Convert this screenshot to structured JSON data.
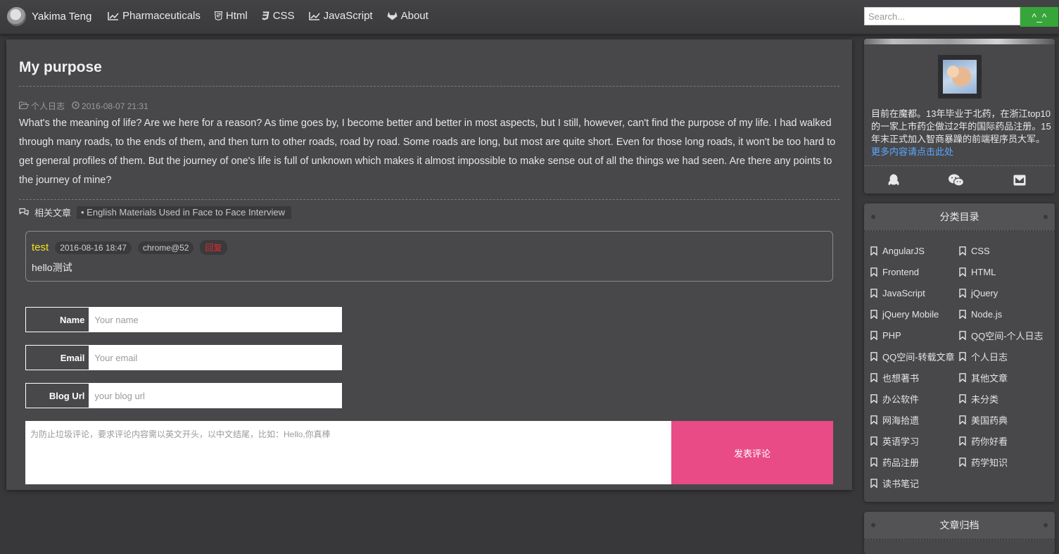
{
  "nav": {
    "brand": "Yakima Teng",
    "items": [
      {
        "label": "Pharmaceuticals",
        "icon": "line-chart-icon"
      },
      {
        "label": "Html",
        "icon": "html5-icon"
      },
      {
        "label": "CSS",
        "icon": "css3-icon"
      },
      {
        "label": "JavaScript",
        "icon": "line-chart-icon"
      },
      {
        "label": "About",
        "icon": "gitlab-icon"
      }
    ],
    "search_placeholder": "Search...",
    "search_button": "^_^"
  },
  "article": {
    "title": "My purpose",
    "category": "个人日志",
    "date": "2016-08-07 21:31",
    "body": "What's the meaning of life? Are we  here for a reason? As time goes by, I become better and better in most aspects, but I still, however, can't find the purpose of my life. I had walked through many roads, to the ends of them, and then turn to other roads, road by road. Some roads are long, but most are quite short. Even for those long roads, it won't be too hard to get general profiles of them. But the journey of one's life is full of unknown which makes it almost impossible to make sense out of all the things we had seen. Are there any points to the journey of mine?",
    "related_label": "相关文章",
    "related_links": [
      "• English Materials Used in Face to Face Interview"
    ]
  },
  "comments": [
    {
      "author": "test",
      "date": "2016-08-16 18:47",
      "browser": "chrome@52",
      "reply": "回复",
      "text": "hello测试"
    }
  ],
  "form": {
    "name_label": "Name",
    "name_placeholder": "Your name",
    "email_label": "Email",
    "email_placeholder": "Your email",
    "blog_label": "Blog Url",
    "blog_placeholder": "your blog url",
    "comment_placeholder": "为防止垃圾评论，要求评论内容需以英文开头，以中文结尾，比如：Hello,你真棒",
    "submit": "发表评论"
  },
  "sidebar": {
    "bio": "目前在魔都。13年毕业于北药，在浙江top10的一家上市药企做过2年的国际药品注册。15年末正式加入智商暴躁的前端程序员大军。",
    "bio_link": "更多内容请点击此处",
    "social": [
      "qq-icon",
      "wechat-icon",
      "mail-icon"
    ],
    "categories_title": "分类目录",
    "categories": [
      "AngularJS",
      "CSS",
      "Frontend",
      "HTML",
      "JavaScript",
      "jQuery",
      "jQuery Mobile",
      "Node.js",
      "PHP",
      "QQ空间-个人日志",
      "QQ空间-转载文章",
      "个人日志",
      "也想著书",
      "其他文章",
      "办公软件",
      "未分类",
      "网海拾遗",
      "美国药典",
      "英语学习",
      "药你好看",
      "药品注册",
      "药学知识",
      "读书笔记"
    ],
    "archive_title": "文章归档"
  },
  "colors": {
    "accent_green": "#36a53a",
    "submit_pink": "#e84b86",
    "author_yellow": "#f1e21e",
    "reply_red": "#e02c2c",
    "link_blue": "#5aa8ff"
  }
}
